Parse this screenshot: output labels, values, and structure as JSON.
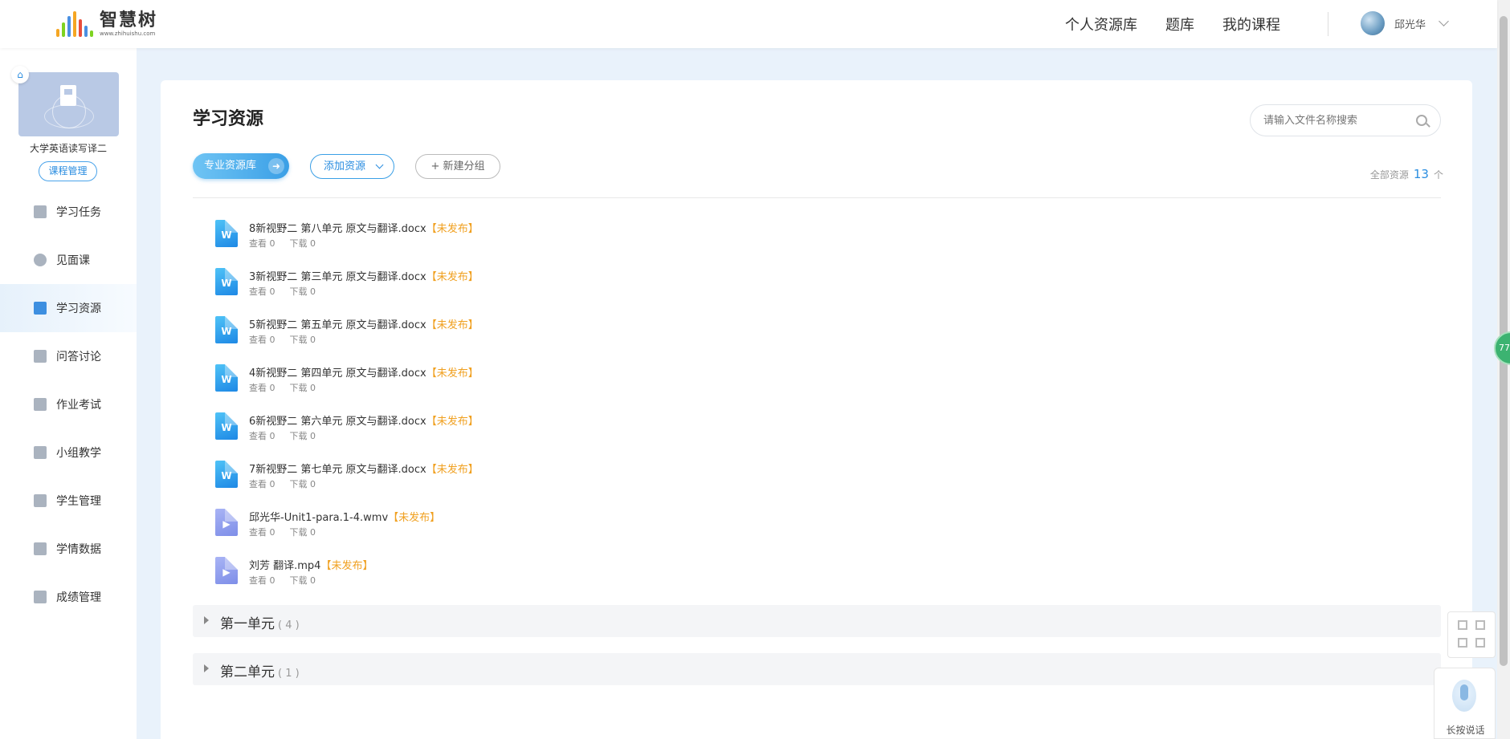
{
  "header": {
    "logo_text": "智慧树",
    "logo_sub": "www.zhihuishu.com",
    "nav": [
      "个人资源库",
      "题库",
      "我的课程"
    ],
    "user_name": "邱光华"
  },
  "sidebar": {
    "course_name": "大学英语读写译二",
    "course_manage": "课程管理",
    "items": [
      {
        "label": "学习任务",
        "icon": "task-icon"
      },
      {
        "label": "见面课",
        "icon": "person-icon"
      },
      {
        "label": "学习资源",
        "icon": "book-icon",
        "active": true
      },
      {
        "label": "问答讨论",
        "icon": "question-icon"
      },
      {
        "label": "作业考试",
        "icon": "exam-icon"
      },
      {
        "label": "小组教学",
        "icon": "group-icon"
      },
      {
        "label": "学生管理",
        "icon": "graduation-cap-icon"
      },
      {
        "label": "学情数据",
        "icon": "bar-chart-icon"
      },
      {
        "label": "成绩管理",
        "icon": "grade-icon"
      }
    ]
  },
  "main": {
    "title": "学习资源",
    "search_placeholder": "请输入文件名称搜索",
    "btn_pro": "专业资源库",
    "btn_add": "添加资源",
    "btn_group": "+ 新建分组",
    "total_label": "全部资源",
    "total_count": "13",
    "total_unit": "个",
    "files": [
      {
        "name": "8新视野二 第八单元 原文与翻译.docx",
        "status": "【未发布】",
        "views": "查看 0",
        "downloads": "下载 0",
        "type": "word"
      },
      {
        "name": "3新视野二 第三单元 原文与翻译.docx",
        "status": "【未发布】",
        "views": "查看 0",
        "downloads": "下载 0",
        "type": "word"
      },
      {
        "name": "5新视野二 第五单元 原文与翻译.docx",
        "status": "【未发布】",
        "views": "查看 0",
        "downloads": "下载 0",
        "type": "word"
      },
      {
        "name": "4新视野二 第四单元 原文与翻译.docx",
        "status": "【未发布】",
        "views": "查看 0",
        "downloads": "下载 0",
        "type": "word"
      },
      {
        "name": "6新视野二 第六单元 原文与翻译.docx",
        "status": "【未发布】",
        "views": "查看 0",
        "downloads": "下载 0",
        "type": "word"
      },
      {
        "name": "7新视野二 第七单元 原文与翻译.docx",
        "status": "【未发布】",
        "views": "查看 0",
        "downloads": "下载 0",
        "type": "word"
      },
      {
        "name": "邱光华-Unit1-para.1-4.wmv",
        "status": "【未发布】",
        "views": "查看 0",
        "downloads": "下载 0",
        "type": "video"
      },
      {
        "name": "刘芳 翻译.mp4",
        "status": "【未发布】",
        "views": "查看 0",
        "downloads": "下载 0",
        "type": "video"
      }
    ],
    "groups": [
      {
        "name": "第一单元",
        "count": "( 4 )"
      },
      {
        "name": "第二单元",
        "count": "( 1 )"
      }
    ]
  },
  "floating": {
    "badge": "77",
    "voice_label": "长按说话"
  }
}
